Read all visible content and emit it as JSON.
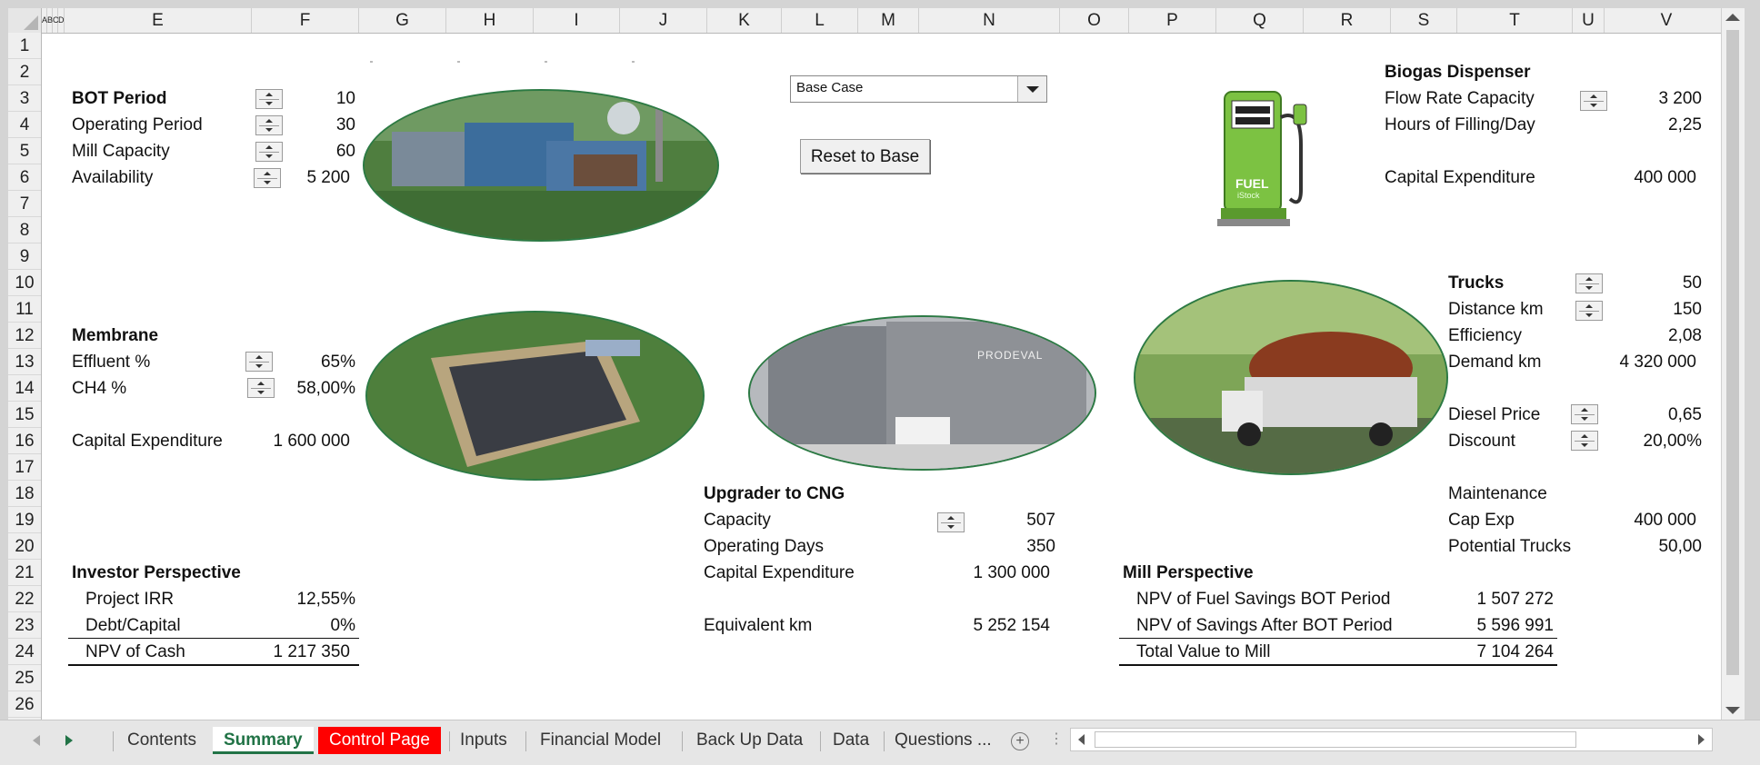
{
  "columns": [
    {
      "label": "A"
    },
    {
      "label": "B"
    },
    {
      "label": "C"
    },
    {
      "label": "D"
    },
    {
      "label": "E"
    },
    {
      "label": "F"
    },
    {
      "label": "G"
    },
    {
      "label": "H"
    },
    {
      "label": "I"
    },
    {
      "label": "J"
    },
    {
      "label": "K"
    },
    {
      "label": "L"
    },
    {
      "label": "M"
    },
    {
      "label": "N"
    },
    {
      "label": "O"
    },
    {
      "label": "P"
    },
    {
      "label": "Q"
    },
    {
      "label": "R"
    },
    {
      "label": "S"
    },
    {
      "label": "T"
    },
    {
      "label": "U"
    },
    {
      "label": "V"
    }
  ],
  "rows": [
    "1",
    "2",
    "3",
    "4",
    "5",
    "6",
    "7",
    "8",
    "9",
    "10",
    "11",
    "12",
    "13",
    "14",
    "15",
    "16",
    "17",
    "18",
    "19",
    "20",
    "21",
    "22",
    "23",
    "24",
    "25",
    "26"
  ],
  "bot": {
    "title": "BOT Period",
    "title_value": "10",
    "operating_label": "Operating Period",
    "operating_value": "30",
    "mill_label": "Mill Capacity",
    "mill_value": "60",
    "avail_label": "Availability",
    "avail_value": "5 200"
  },
  "membrane": {
    "title": "Membrane",
    "effluent_label": "Effluent %",
    "effluent_value": "65%",
    "ch4_label": "CH4 %",
    "ch4_value": "58,00%",
    "capex_label": "Capital Expenditure",
    "capex_value": "1 600 000"
  },
  "investor": {
    "title": "Investor Perspective",
    "irr_label": "Project IRR",
    "irr_value": "12,55%",
    "debt_label": "Debt/Capital",
    "debt_value": "0%",
    "npv_label": "NPV of Cash",
    "npv_value": "1 217 350"
  },
  "scenario": {
    "selected": "Base Case",
    "reset_label": "Reset to Base"
  },
  "upgrader": {
    "title": "Upgrader to CNG",
    "capacity_label": "Capacity",
    "capacity_value": "507",
    "days_label": "Operating Days",
    "days_value": "350",
    "capex_label": "Capital Expenditure",
    "capex_value": "1 300 000",
    "eqkm_label": "Equivalent km",
    "eqkm_value": "5 252 154"
  },
  "mill": {
    "title": "Mill Perspective",
    "npv_bot_label": "NPV of Fuel Savings BOT Period",
    "npv_bot_value": "1 507 272",
    "npv_after_label": "NPV of Savings After BOT Period",
    "npv_after_value": "5 596 991",
    "total_label": "Total Value to Mill",
    "total_value": "7 104 264"
  },
  "dispenser": {
    "title": "Biogas Dispenser",
    "flow_label": "Flow Rate Capacity",
    "flow_value": "3 200",
    "hours_label": "Hours of Filling/Day",
    "hours_value": "2,25",
    "capex_label": "Capital Expenditure",
    "capex_value": "400 000",
    "pump_text": "FUEL",
    "pump_sub": "iStock"
  },
  "trucks": {
    "title": "Trucks",
    "title_value": "50",
    "distance_label": "Distance km",
    "distance_value": "150",
    "efficiency_label": "Efficiency",
    "efficiency_value": "2,08",
    "demand_label": "Demand km",
    "demand_value": "4 320 000",
    "diesel_label": "Diesel Price",
    "diesel_value": "0,65",
    "discount_label": "Discount",
    "discount_value": "20,00%",
    "maint_label": "Maintenance",
    "capexp_label": "Cap Exp",
    "capexp_value": "400 000",
    "potential_label": "Potential Trucks",
    "potential_value": "50,00"
  },
  "images": {
    "container_brand": "PRODEVAL"
  },
  "tabs": [
    "Contents",
    "Summary",
    "Control Page",
    "Inputs",
    "Financial Model",
    "Back Up Data",
    "Data",
    "Questions ..."
  ],
  "colors": {
    "tab_active": "#217346",
    "tab_red": "#ff0000",
    "ellipse_border": "#2c7a44"
  }
}
